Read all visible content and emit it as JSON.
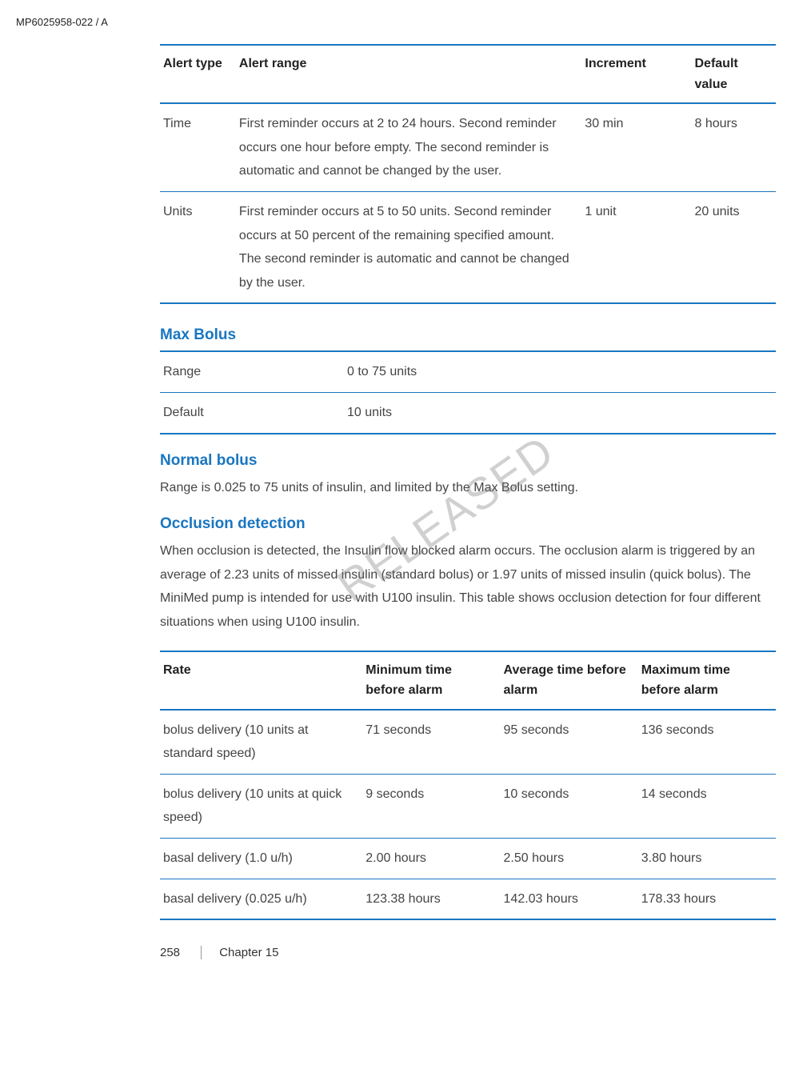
{
  "doc_id": "MP6025958-022 / A",
  "alert_table": {
    "headers": [
      "Alert type",
      "Alert range",
      "Increment",
      "Default value"
    ],
    "rows": [
      {
        "type": "Time",
        "range": "First reminder occurs at 2 to 24 hours. Second reminder occurs one hour before empty. The second reminder is automatic and cannot be changed by the user.",
        "inc": "30 min",
        "def": "8 hours"
      },
      {
        "type": "Units",
        "range": "First reminder occurs at 5 to 50 units. Second reminder occurs at 50 percent of the remaining specified amount. The second reminder is automatic and cannot be changed by the user.",
        "inc": "1 unit",
        "def": "20 units"
      }
    ]
  },
  "max_bolus": {
    "title": "Max Bolus",
    "rows": [
      {
        "label": "Range",
        "value": "0 to 75 units"
      },
      {
        "label": "Default",
        "value": "10 units"
      }
    ]
  },
  "normal_bolus": {
    "title": "Normal bolus",
    "text": "Range is 0.025 to 75 units of insulin, and limited by the Max Bolus setting."
  },
  "occlusion": {
    "title": "Occlusion detection",
    "text": "When occlusion is detected, the Insulin flow blocked alarm occurs. The occlusion alarm is triggered by an average of 2.23 units of missed insulin (standard bolus) or 1.97 units of missed insulin (quick bolus). The MiniMed pump is intended for use with U100 insulin. This table shows occlusion detection for four different situations when using U100 insulin.",
    "headers": [
      "Rate",
      "Minimum time before alarm",
      "Average time before alarm",
      "Maximum time before alarm"
    ],
    "rows": [
      {
        "rate": "bolus delivery (10 units at standard speed)",
        "min": "71 seconds",
        "avg": "95 seconds",
        "max": "136 seconds"
      },
      {
        "rate": "bolus delivery (10 units at quick speed)",
        "min": "9 seconds",
        "avg": "10 seconds",
        "max": "14 seconds"
      },
      {
        "rate": "basal delivery (1.0 u/h)",
        "min": "2.00 hours",
        "avg": "2.50 hours",
        "max": "3.80 hours"
      },
      {
        "rate": "basal delivery (0.025 u/h)",
        "min": "123.38 hours",
        "avg": "142.03 hours",
        "max": "178.33 hours"
      }
    ]
  },
  "watermark": "RELEASED",
  "footer": {
    "page": "258",
    "chapter": "Chapter 15"
  }
}
